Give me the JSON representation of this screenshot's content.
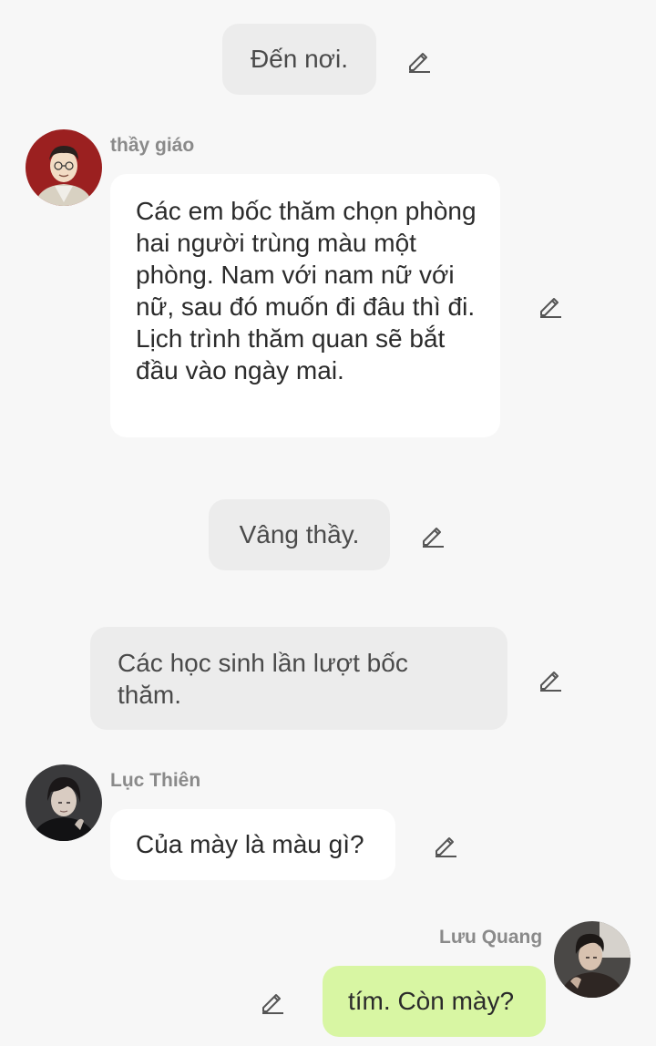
{
  "messages": [
    {
      "type": "narration",
      "text": "Đến nơi.",
      "edit_icon": "pencil-edit-icon"
    },
    {
      "type": "incoming",
      "sender": "thầy giáo",
      "avatar_icon": "teacher-avatar",
      "text": "Các em bốc thăm chọn phòng hai người trùng màu một phòng. Nam với nam nữ với nữ, sau đó muốn đi đâu thì đi. Lịch trình thăm quan sẽ bắt đầu vào ngày mai.",
      "edit_icon": "pencil-edit-icon"
    },
    {
      "type": "narration",
      "text": "Vâng thầy.",
      "edit_icon": "pencil-edit-icon"
    },
    {
      "type": "narration",
      "text": "Các học sinh lần lượt bốc thăm.",
      "edit_icon": "pencil-edit-icon"
    },
    {
      "type": "incoming",
      "sender": "Lục Thiên",
      "avatar_icon": "luc-thien-avatar",
      "text": "Của mày là màu gì?",
      "edit_icon": "pencil-edit-icon"
    },
    {
      "type": "outgoing",
      "sender": "Lưu Quang",
      "avatar_icon": "luu-quang-avatar",
      "text": "tím. Còn mày?",
      "edit_icon": "pencil-edit-icon"
    }
  ],
  "colors": {
    "background": "#f7f7f7",
    "narration_bubble": "#ececec",
    "incoming_bubble": "#ffffff",
    "outgoing_bubble": "#d8f6a3",
    "sender_name": "#8a8a8a",
    "text": "#2b2b2b"
  }
}
